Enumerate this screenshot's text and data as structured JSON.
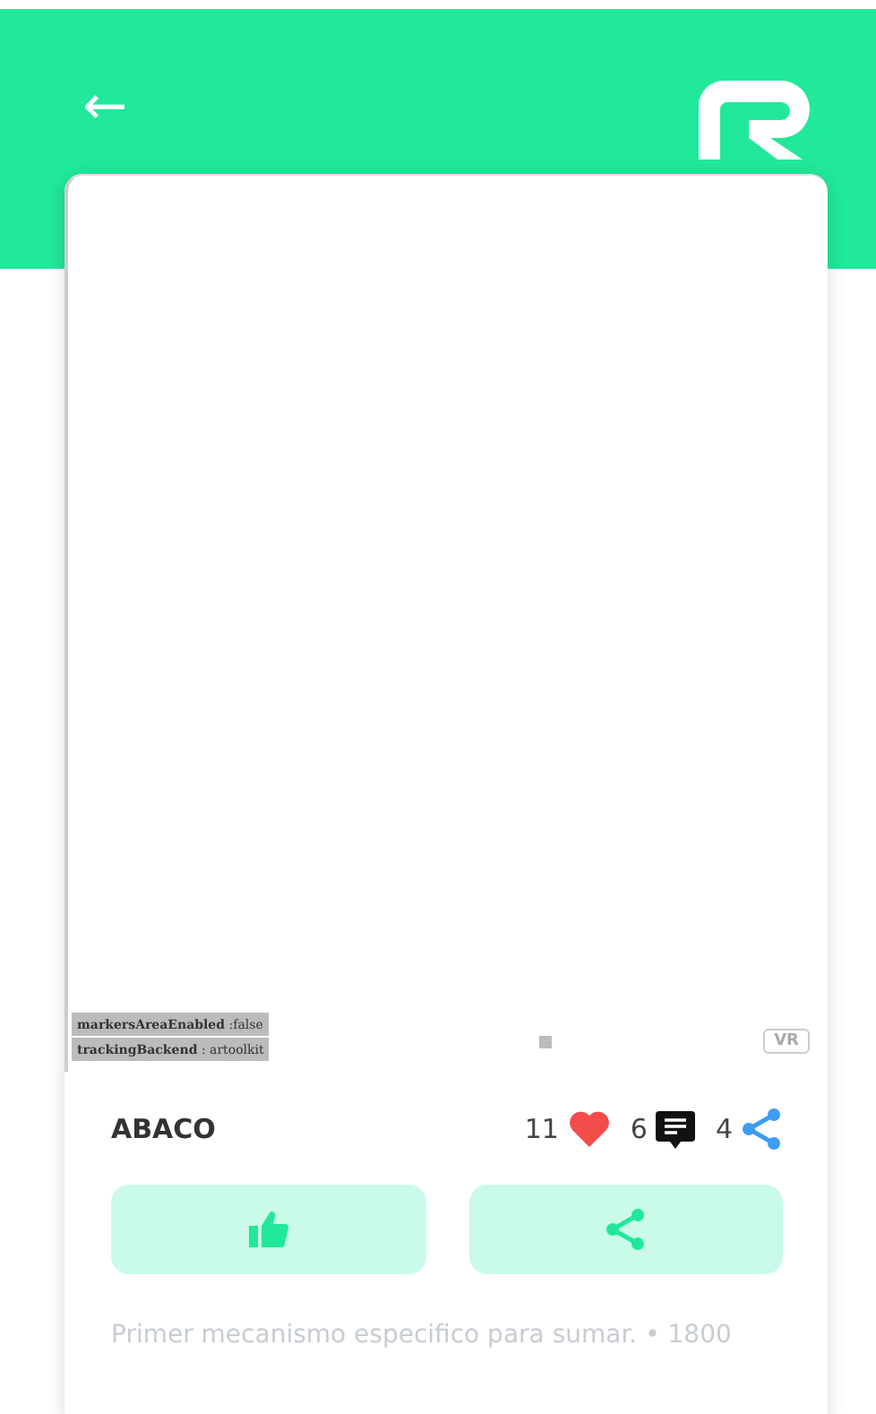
{
  "header": {
    "back": "←"
  },
  "viewer": {
    "debug": [
      {
        "key": "markersAreaEnabled",
        "value": " :false"
      },
      {
        "key": "trackingBackend",
        "value": " : artoolkit"
      }
    ],
    "vr_badge": "VR"
  },
  "item": {
    "title": "ABACO",
    "likes": "11",
    "comments": "6",
    "shares": "4",
    "description": "Primer mecanismo especifico para sumar. • 1800"
  }
}
